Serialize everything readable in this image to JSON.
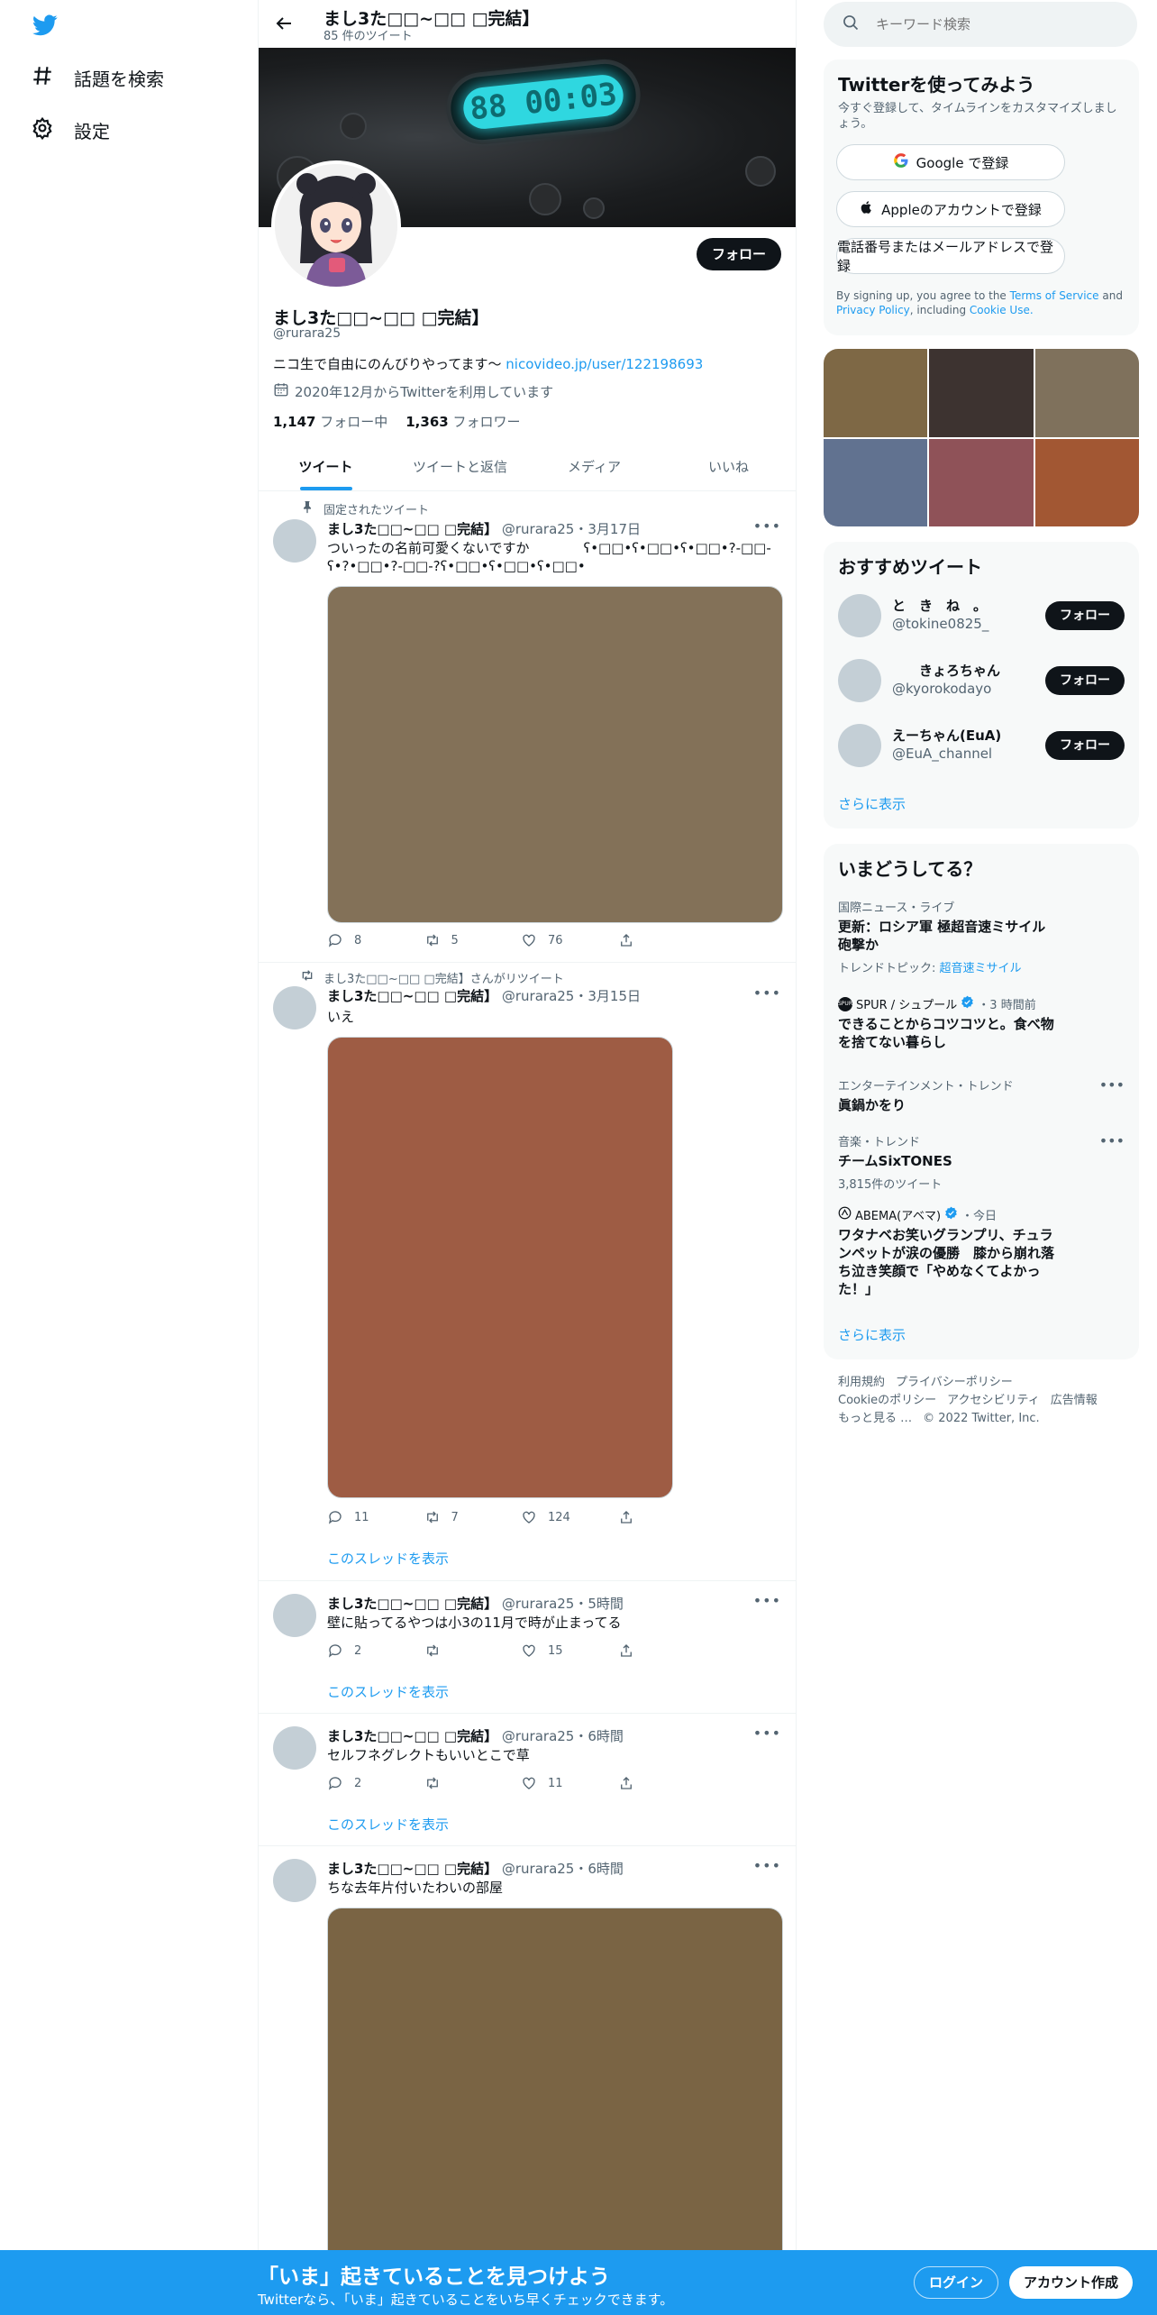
{
  "nav": {
    "items": [
      {
        "label": "話題を検索",
        "icon": "hashtag-icon"
      },
      {
        "label": "設定",
        "icon": "gear-icon"
      }
    ]
  },
  "header": {
    "name": "まし3た□□~□□ □完結】",
    "tweet_count": "85 件のツイート"
  },
  "banner": {
    "display": "88 00:03"
  },
  "profile": {
    "follow_label": "フォロー",
    "name": "まし3た□□~□□ □完結】",
    "handle": "@rurara25",
    "bio": "ニコ生で自由にのんびりやってます〜",
    "bio_link": "nicovideo.jp/user/122198693",
    "joined": "2020年12月からTwitterを利用しています",
    "following_count": "1,147",
    "following_label": "フォロー中",
    "followers_count": "1,363",
    "followers_label": "フォロワー"
  },
  "tabs": [
    "ツイート",
    "ツイートと返信",
    "メディア",
    "いいね"
  ],
  "tweets": [
    {
      "context": "固定されたツイート",
      "name": "まし3た□□~□□ □完結】",
      "meta": "@rurara25・3月17日",
      "text": "ついったの名前可愛くないですか　　　　ʕ•□□•ʕ•□□•ʕ•□□•?-□□-\nʕ•?•□□•?-□□-?ʕ•□□•ʕ•□□•ʕ•□□•",
      "media_color": "#837158",
      "replies": "8",
      "retweets": "5",
      "likes": "76"
    },
    {
      "context": "まし3た□□~□□ □完結】さんがリツイート",
      "name": "まし3た□□~□□ □完結】",
      "meta": "@rurara25・3月15日",
      "text": "いえ",
      "media_color": "#9e5c44",
      "replies": "11",
      "retweets": "7",
      "likes": "124",
      "show_thread": "このスレッドを表示"
    },
    {
      "name": "まし3た□□~□□ □完結】",
      "meta": "@rurara25・5時間",
      "text": "壁に貼ってるやつは小3の11月で時が止まってる",
      "replies": "2",
      "retweets": "",
      "likes": "15",
      "show_thread": "このスレッドを表示"
    },
    {
      "name": "まし3た□□~□□ □完結】",
      "meta": "@rurara25・6時間",
      "text": "セルフネグレクトもいいとこで草",
      "replies": "2",
      "retweets": "",
      "likes": "11",
      "show_thread": "このスレッドを表示"
    },
    {
      "name": "まし3た□□~□□ □完結】",
      "meta": "@rurara25・6時間",
      "text": "ちな去年片付いたわいの部屋",
      "media_color": "#7a6444"
    }
  ],
  "search": {
    "placeholder": "キーワード検索"
  },
  "signup": {
    "title": "Twitterを使ってみよう",
    "subtitle": "今すぐ登録して、タイムラインをカスタマイズしましょう。",
    "google": "Google で登録",
    "apple": "Appleのアカウントで登録",
    "phone": "電話番号またはメールアドレスで登録",
    "terms_prefix": "By signing up, you agree to the",
    "terms": "Terms of Service",
    "and": "and",
    "privacy": "Privacy Policy",
    "including": ", including",
    "cookie": "Cookie Use."
  },
  "photos": [
    "#7e6845",
    "#3d3330",
    "#7f715c",
    "#617290",
    "#8f5258",
    "#a25733"
  ],
  "recommended": {
    "title": "おすすめツイート",
    "accounts": [
      {
        "name": "と　き　ね　。",
        "handle": "@tokine0825_"
      },
      {
        "name": "　　きょろちゃん",
        "handle": "@kyorokodayo"
      },
      {
        "name": "えーちゃん(EuA)",
        "handle": "@EuA_channel"
      }
    ],
    "follow_label": "フォロー",
    "show_more": "さらに表示"
  },
  "trends": {
    "title": "いまどうしてる？",
    "items": [
      {
        "meta": "国際ニュース・ライブ",
        "title": "更新：ロシア軍 極超音速ミサイル砲撃か",
        "sub_prefix": "トレンドトピック:",
        "sub_link": "超音速ミサイル"
      },
      {
        "meta": "SPUR / シュプール",
        "meta_time": "・3 時間前",
        "title": "できることからコツコツと。食べ物を捨てない暮らし"
      },
      {
        "meta": "エンターテインメント・トレンド",
        "title": "眞鍋かをり"
      },
      {
        "meta": "音楽・トレンド",
        "title": "チームSixTONES",
        "sub": "3,815件のツイート"
      },
      {
        "meta": "ABEMA(アベマ)",
        "meta_time": "・今日",
        "title": "ワタナベお笑いグランプリ、チュランペットが涙の優勝　膝から崩れ落ち泣き笑顔で「やめなくてよかった！」"
      }
    ],
    "show_more": "さらに表示"
  },
  "footer": {
    "links": [
      "利用規約",
      "プライバシーポリシー",
      "Cookieのポリシー",
      "アクセシビリティ",
      "広告情報",
      "もっと見る …"
    ],
    "copyright": "© 2022 Twitter, Inc."
  },
  "bottom_bar": {
    "title": "「いま」起きていることを見つけよう",
    "subtitle": "Twitterなら、「いま」起きていることをいち早くチェックできます。",
    "login": "ログイン",
    "signup": "アカウント作成"
  },
  "colors": {
    "accent": "#1d9bf0",
    "text": "#0f1419",
    "muted": "#536471"
  }
}
